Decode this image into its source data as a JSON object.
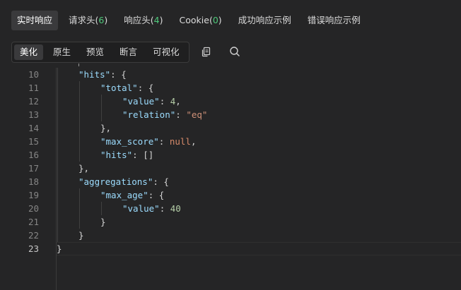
{
  "tabs": [
    {
      "label": "实时响应",
      "count": "",
      "active": true
    },
    {
      "label": "请求头",
      "count": "6"
    },
    {
      "label": "响应头",
      "count": "4"
    },
    {
      "label": "Cookie",
      "count": "0"
    },
    {
      "label": "成功响应示例",
      "count": ""
    },
    {
      "label": "错误响应示例",
      "count": ""
    }
  ],
  "view_modes": [
    "美化",
    "原生",
    "预览",
    "断言",
    "可视化"
  ],
  "toolbar_icons": [
    "copy-icon",
    "search-icon"
  ],
  "code": {
    "current_line": "23",
    "lines": [
      {
        "no": "10",
        "indent": 1,
        "tokens": [
          {
            "t": "\"hits\"",
            "c": "k"
          },
          {
            "t": ": {",
            "c": "p"
          }
        ]
      },
      {
        "no": "11",
        "indent": 2,
        "tokens": [
          {
            "t": "\"total\"",
            "c": "k"
          },
          {
            "t": ": {",
            "c": "p"
          }
        ]
      },
      {
        "no": "12",
        "indent": 3,
        "tokens": [
          {
            "t": "\"value\"",
            "c": "k"
          },
          {
            "t": ": ",
            "c": "p"
          },
          {
            "t": "4",
            "c": "n"
          },
          {
            "t": ",",
            "c": "p"
          }
        ]
      },
      {
        "no": "13",
        "indent": 3,
        "tokens": [
          {
            "t": "\"relation\"",
            "c": "k"
          },
          {
            "t": ": ",
            "c": "p"
          },
          {
            "t": "\"eq\"",
            "c": "s"
          }
        ]
      },
      {
        "no": "14",
        "indent": 2,
        "tokens": [
          {
            "t": "},",
            "c": "p"
          }
        ]
      },
      {
        "no": "15",
        "indent": 2,
        "tokens": [
          {
            "t": "\"max_score\"",
            "c": "k"
          },
          {
            "t": ": ",
            "c": "p"
          },
          {
            "t": "null",
            "c": "kw"
          },
          {
            "t": ",",
            "c": "p"
          }
        ]
      },
      {
        "no": "16",
        "indent": 2,
        "tokens": [
          {
            "t": "\"hits\"",
            "c": "k"
          },
          {
            "t": ": []",
            "c": "p"
          }
        ]
      },
      {
        "no": "17",
        "indent": 1,
        "tokens": [
          {
            "t": "},",
            "c": "p"
          }
        ]
      },
      {
        "no": "18",
        "indent": 1,
        "tokens": [
          {
            "t": "\"aggregations\"",
            "c": "k"
          },
          {
            "t": ": {",
            "c": "p"
          }
        ]
      },
      {
        "no": "19",
        "indent": 2,
        "tokens": [
          {
            "t": "\"max_age\"",
            "c": "k"
          },
          {
            "t": ": {",
            "c": "p"
          }
        ]
      },
      {
        "no": "20",
        "indent": 3,
        "tokens": [
          {
            "t": "\"value\"",
            "c": "k"
          },
          {
            "t": ": ",
            "c": "p"
          },
          {
            "t": "40",
            "c": "n"
          }
        ]
      },
      {
        "no": "21",
        "indent": 2,
        "tokens": [
          {
            "t": "}",
            "c": "p"
          }
        ]
      },
      {
        "no": "22",
        "indent": 1,
        "tokens": [
          {
            "t": "}",
            "c": "p"
          }
        ]
      },
      {
        "no": "23",
        "indent": 0,
        "tokens": [
          {
            "t": "}",
            "c": "p"
          }
        ]
      }
    ]
  },
  "colors": {
    "background": "#252526",
    "key": "#9cdcfe",
    "string": "#ce9178",
    "number": "#b5cea8",
    "keyword": "#d78a6a",
    "count": "#4ec97a"
  }
}
